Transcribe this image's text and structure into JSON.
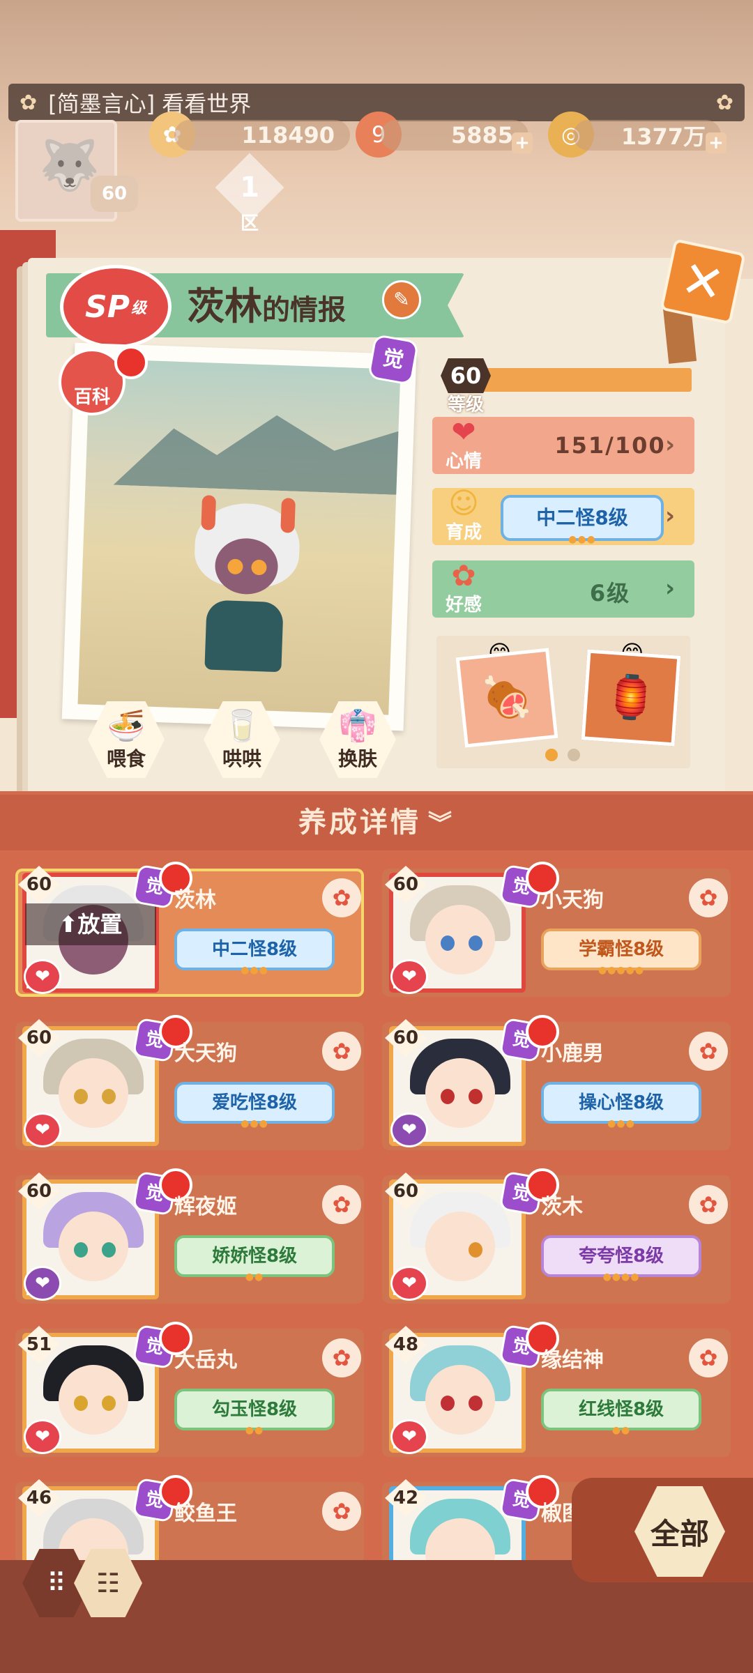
{
  "top": {
    "announcement": "[简墨言心] 看看世界",
    "resources": {
      "flower": "118490",
      "nine": "5885",
      "coins": "1377万"
    },
    "player_level": "60",
    "zone_number": "1",
    "zone_label": "区"
  },
  "info": {
    "rank_badge": "SP",
    "rank_badge_suffix": "级",
    "name": "茨林",
    "title_suffix": "的情报",
    "encyclopedia": "百科",
    "awaken_badge": "觉",
    "level_value": "60",
    "level_label": "等级",
    "mood_label": "心情",
    "mood_value": "151/100",
    "grow_label": "育成",
    "grow_value": "中二怪8级",
    "grow_dots": "●●●",
    "favor_label": "好感",
    "favor_value": "6级",
    "actions": [
      "喂食",
      "哄哄",
      "换肤"
    ],
    "level_progress": 1.0
  },
  "detail": {
    "header": "养成详情",
    "cards": [
      {
        "level": "60",
        "name": "茨林",
        "tag": "中二怪8级",
        "dots": "●●●",
        "style": "blue",
        "place": "⬆放置"
      },
      {
        "level": "60",
        "name": "小天狗",
        "tag": "学霸怪8级",
        "dots": "●●●●●",
        "style": "orange"
      },
      {
        "level": "60",
        "name": "大天狗",
        "tag": "爱吃怪8级",
        "dots": "●●●",
        "style": "blue"
      },
      {
        "level": "60",
        "name": "小鹿男",
        "tag": "操心怪8级",
        "dots": "●●●",
        "style": "blue"
      },
      {
        "level": "60",
        "name": "辉夜姬",
        "tag": "娇娇怪8级",
        "dots": "●●",
        "style": "green"
      },
      {
        "level": "60",
        "name": "茨木",
        "tag": "夸夸怪8级",
        "dots": "●●●●",
        "style": "purple"
      },
      {
        "level": "51",
        "name": "大岳丸",
        "tag": "勾玉怪8级",
        "dots": "●●",
        "style": "green"
      },
      {
        "level": "48",
        "name": "缘结神",
        "tag": "红线怪8级",
        "dots": "●●",
        "style": "green"
      },
      {
        "level": "46",
        "name": "鲛鱼王",
        "tag": "",
        "dots": "",
        "style": "blue"
      },
      {
        "level": "42",
        "name": "椒图",
        "tag": "",
        "dots": "",
        "style": "blue"
      }
    ],
    "jue": "觉"
  },
  "controls": {
    "filter_all": "全部"
  }
}
